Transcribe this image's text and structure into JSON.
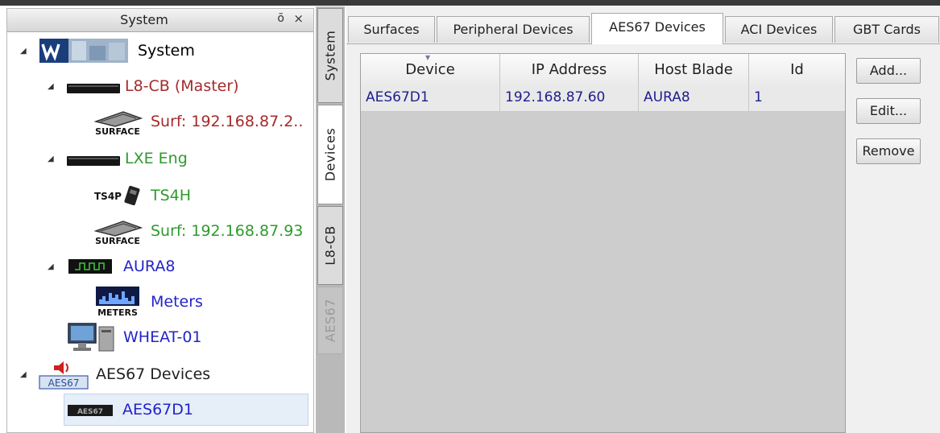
{
  "system_panel": {
    "title": "System",
    "pin_glyph": "õ",
    "close_glyph": "×",
    "tree": [
      {
        "label": "System",
        "icon": "wheatstone-logo-icon",
        "color": "#222222"
      },
      {
        "label": "L8-CB (Master)",
        "icon": "blade-device-icon",
        "color": "#a52a2a"
      },
      {
        "label": "Surf: 192.168.87.2..",
        "icon": "surface-icon",
        "icon_text": "SURFACE",
        "color": "#a52a2a"
      },
      {
        "label": "LXE Eng",
        "icon": "blade-device-icon",
        "color": "#2e9a2e"
      },
      {
        "label": "TS4H",
        "icon": "ts4p-icon",
        "icon_text": "TS4P",
        "color": "#2e9a2e"
      },
      {
        "label": "Surf: 192.168.87.93",
        "icon": "surface-icon",
        "icon_text": "SURFACE",
        "color": "#2e9a2e"
      },
      {
        "label": "AURA8",
        "icon": "aura-device-icon",
        "color": "#2424c8"
      },
      {
        "label": "Meters",
        "icon": "meters-icon",
        "icon_text": "METERS",
        "color": "#2424c8"
      },
      {
        "label": "WHEAT-01",
        "icon": "computer-icon",
        "color": "#2424c8"
      },
      {
        "label": "AES67 Devices",
        "icon": "aes67-speaker-icon",
        "icon_text": "AES67",
        "color": "#222222"
      },
      {
        "label": "AES67D1",
        "icon": "aes67-device-icon",
        "icon_text": "AES67",
        "color": "#2424c8"
      }
    ]
  },
  "vertical_tabs": [
    "System",
    "Devices",
    "L8-CB",
    "AES67"
  ],
  "top_tabs": [
    "Surfaces",
    "Peripheral Devices",
    "AES67 Devices",
    "ACI Devices",
    "GBT Cards"
  ],
  "active_top_tab": "AES67 Devices",
  "grid": {
    "columns": [
      "Device",
      "IP Address",
      "Host Blade",
      "Id"
    ],
    "rows": [
      [
        "AES67D1",
        "192.168.87.60",
        "AURA8",
        "1"
      ]
    ]
  },
  "buttons": {
    "add": "Add...",
    "edit": "Edit...",
    "remove": "Remove"
  }
}
